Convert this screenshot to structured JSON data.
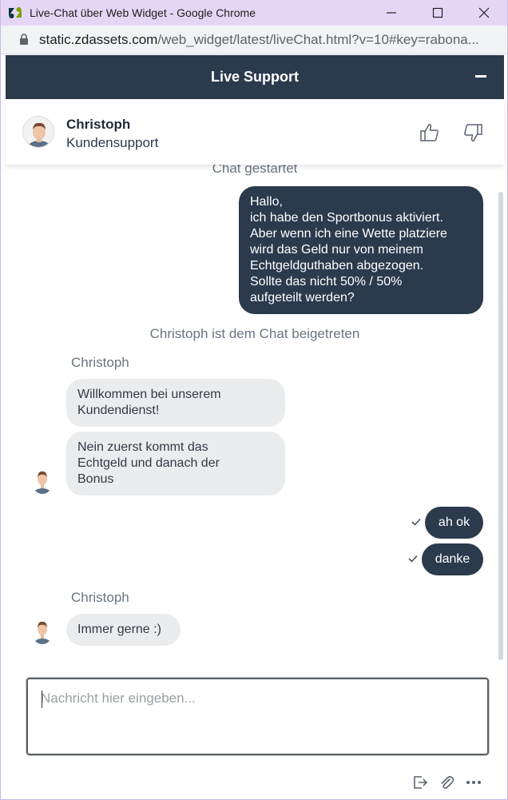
{
  "window": {
    "title": "Live-Chat über Web Widget - Google Chrome",
    "url_host": "static.zdassets.com",
    "url_path": "/web_widget/latest/liveChat.html?v=10#key=rabona..."
  },
  "widget": {
    "header_title": "Live Support"
  },
  "agent": {
    "name": "Christoph",
    "role": "Kundensupport"
  },
  "messages": {
    "system_started": "Chat gestartet",
    "user_msg_1": [
      "Hallo,",
      "ich habe den Sportbonus aktiviert.",
      "Aber wenn ich eine Wette platziere",
      "wird das Geld nur von meinem",
      "Echtgeldguthaben abgezogen.",
      "Sollte das nicht 50% / 50%",
      "aufgeteilt werden?"
    ],
    "system_joined": "Christoph ist dem Chat beigetreten",
    "agent_label_1": "Christoph",
    "agent_msg_1": [
      "Willkommen bei unserem",
      "Kundendienst!"
    ],
    "agent_msg_2": [
      "Nein zuerst kommt das",
      "Echtgeld und danach der",
      "Bonus"
    ],
    "user_msg_2": "ah ok",
    "user_msg_3": "danke",
    "agent_label_2": "Christoph",
    "agent_msg_3": "Immer gerne :)"
  },
  "composer": {
    "placeholder": "Nachricht hier eingeben...",
    "value": ""
  },
  "colors": {
    "header": "#2c3a4e",
    "outgoing_bubble": "#2c3a4e",
    "incoming_bubble": "#ebeced",
    "titlebar": "#e6d6f5"
  }
}
